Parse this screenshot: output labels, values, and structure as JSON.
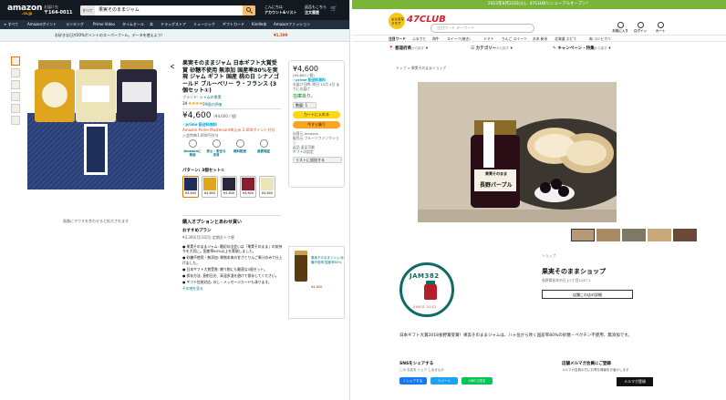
{
  "amazon": {
    "logo": "amazon",
    "logo_sub": ".co.jp",
    "deliver_line1": "お届け先",
    "deliver_line2": "〒164-0011",
    "search_category": "すべて",
    "search_value": "果実そのままジャム",
    "account_line1": "こんにちは",
    "account_line2": "アカウント&リスト",
    "orders_line1": "返品もこちら",
    "orders_line2": "注文履歴",
    "cart_label": "カート",
    "nav": [
      "≡ すべて",
      "Amazonポイント",
      "ランキング",
      "Prime Video",
      "タイムセール",
      "本",
      "ドラッグストア",
      "ミュージック",
      "ギフトカード",
      "Kindle本",
      "Amazonファッション"
    ],
    "banner_text": "お好きな日が20%ポイントのスーパープール。データを使えよう！",
    "banner_price": "¥1,599",
    "product": {
      "title": "果実そのままジャム 日本ギフト大賞受賞 砂糖不使用 無添加 国産率80%を実現 ジャム ギフト 国産 桃の日 シナノゴールド ブルーベリー ラ・フランス (3個セット①)",
      "brand": "ブランド: シャムの果実",
      "rating_value": "3.9",
      "stars": "★★★★☆",
      "rating_count": "59個の評価",
      "price": "¥4,600",
      "price_unit": "(¥4,600 / 個)",
      "prime": "✓prime 配送料無料",
      "points_line": "Amazon Prime Mastercard申込み 2,000ポイント付与",
      "points_line2": "入会特典1,000円付与",
      "features": [
        "Amazonに発送",
        "安心・安全な決済",
        "無料配送",
        "品質保証"
      ],
      "pattern_label": "パターン: 3個セット①",
      "variant_prices": [
        "¥4,600",
        "¥4,600",
        "¥4,600",
        "¥4,600",
        "¥4,600"
      ],
      "options_heading": "購入オプションとあわせ買い",
      "gift_heading": "おすすめプラン",
      "gift_text": "¥3,360/月(10月) 定期おトク便",
      "bullets": [
        "● 果実そのままジャム: 最初の出会いは「果実そのまま」の気持ちを大切に。国産率80%以上を実現しました。",
        "● 砂糖不使用・無添加: 果物本来の甘さとりんご果汁のみで仕上げました。",
        "● 日本ギフト大賞受賞: 贈り物にも最適な3個セット。",
        "● 保存方法: 直射日光、高温多湿を避けて保存してください。",
        "● ギフト包装対応: のし・メッセージカードも承ります。"
      ],
      "more_label": "その他を見る",
      "gallery_note": "画像にマウスを合わせると拡大されます"
    },
    "buybox": {
      "price": "¥4,600",
      "unit": "(¥4,600 / 個)",
      "prime": "✓prime 配送料無料",
      "delivery": "お届け日時: 明日 10月 4日 までにお届け",
      "stock": "在庫あり。",
      "qty": "数量: 1",
      "cart_btn": "カートに入れる",
      "buy_btn": "今すぐ買う",
      "ship_from": "出荷元 Amazon",
      "seller": "販売元 フルーツファンクション",
      "returns": "返品 返品可能",
      "gift_option": "ギフトの設定",
      "list_btn": "リストに追加する"
    },
    "ad": {
      "text": "果実そのままジャム 砂糖不使用 国産率80%",
      "price": "¥4,600"
    }
  },
  "club": {
    "notice": "2023年8月22日(火)、47CLUBリニューアルオープン！",
    "logo_ring": "よんななクラブ",
    "logo_name": "47CLUB",
    "search_placeholder": "注目ワード  キーワード",
    "header_icons": [
      "お気に入り",
      "ログイン",
      "カート"
    ],
    "nav": [
      "注目ワード",
      "ふるさと",
      "和牛",
      "スイーツ(焼き)",
      "トマト",
      "りんご スイーツ",
      "お米 新米",
      "北海道 ぶどう",
      "肉 コシヒカリ"
    ],
    "filters": [
      {
        "label": "都道府県",
        "sub": "から探す"
      },
      {
        "label": "カテゴリー",
        "sub": "から探す"
      },
      {
        "label": "キャンペーン・特集",
        "sub": "から探す"
      }
    ],
    "crumb": "トップ > 果実そのままショップ",
    "jar_label": "果実そのまま",
    "jar_name": "長野パープル",
    "shop_badge": "ショップ",
    "seal_top": "JAM382",
    "seal_bottom": "SINCE 2012",
    "shop_name": "果実そのままショップ",
    "shop_addr": "長野県松本市日上1丁目1247-1",
    "shop_btn": "店舗この店の詳細",
    "description": "日本ギフト大賞2018長野賞受賞！果実そのままジャムは、八ヶ岳から吹く国産率80%の砂糖・ペクチン不使用、無添加です。",
    "share_title": "SNSをシェアする",
    "share_sub": "この お店を シェア しませんか",
    "share_buttons": [
      "f シェアする",
      "ツイート",
      "LINEで送る"
    ],
    "share_colors": [
      "#1877f2",
      "#1da1f2",
      "#06c755"
    ],
    "mm_title": "店舗メルマガ会員にご登録",
    "mm_sub": "メルマガ会員の方にお得な情報をお届けします",
    "mm_btn": "メルマガ登録"
  }
}
